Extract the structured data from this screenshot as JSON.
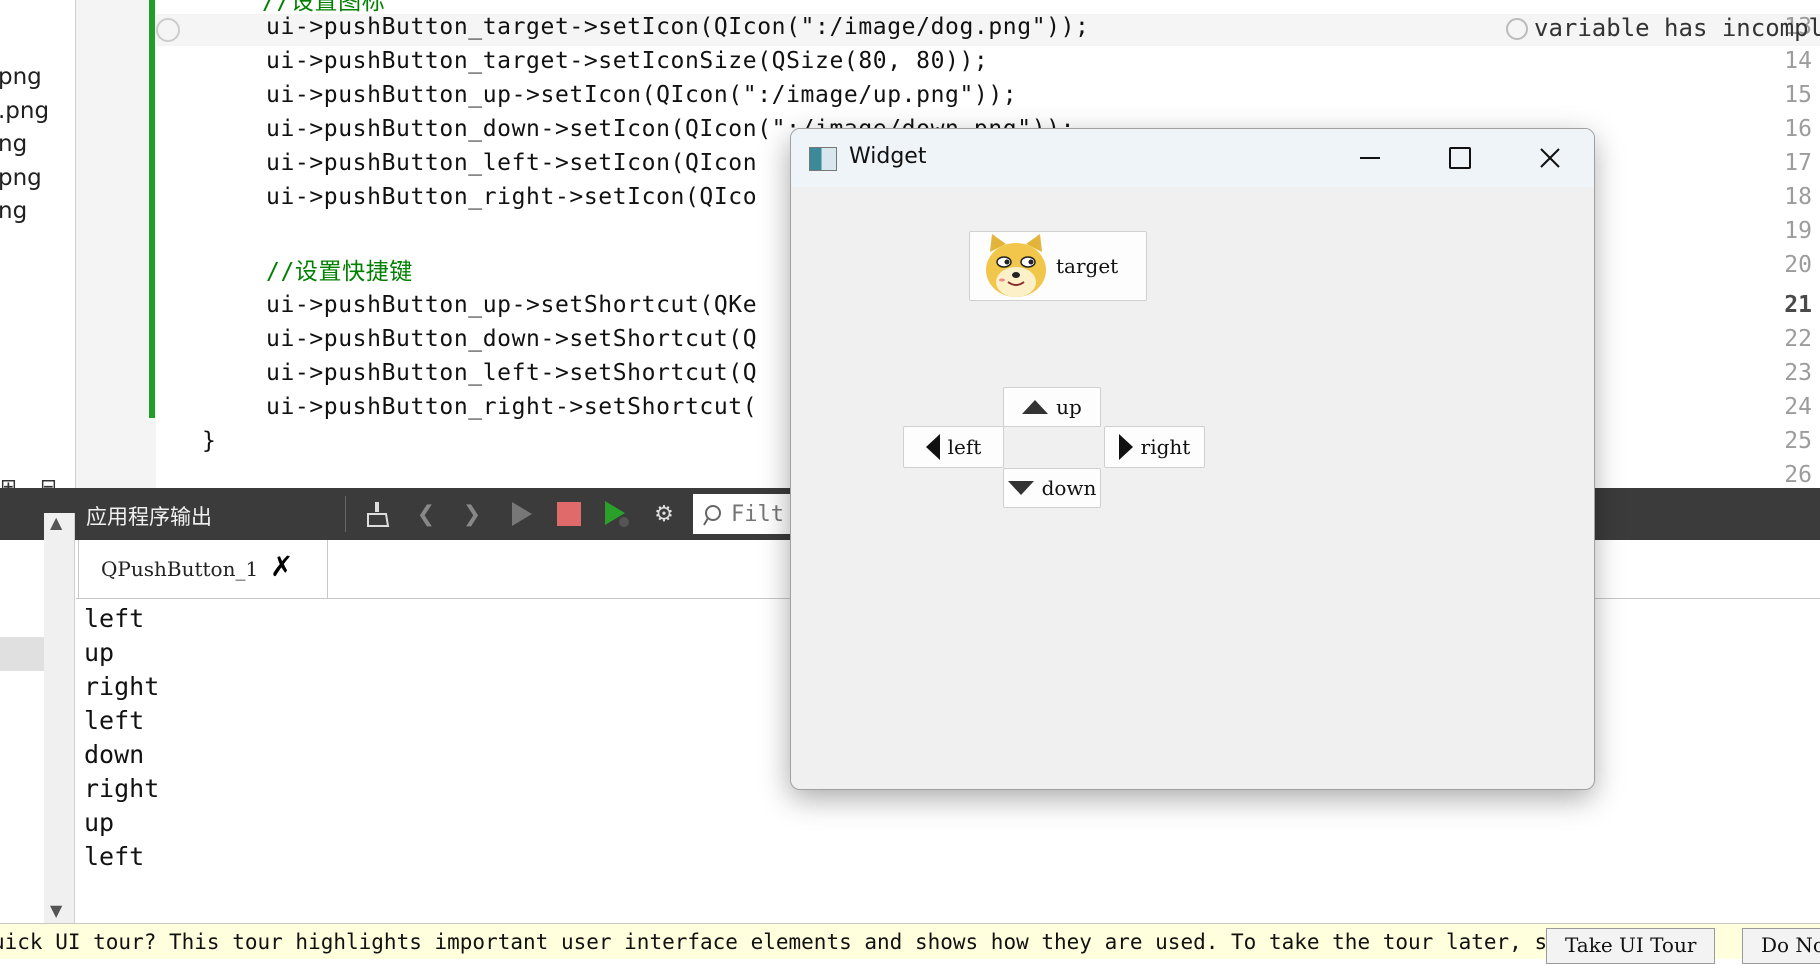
{
  "file_panel": {
    "items": [
      "png",
      ".png",
      "ng",
      "png",
      "ng"
    ]
  },
  "editor": {
    "hidden_top_line": "//设置图标",
    "lines": [
      {
        "no": "13",
        "code": "ui->pushButton_target->setIcon(QIcon(\":/image/dog.png\"));"
      },
      {
        "no": "14",
        "code": "ui->pushButton_target->setIconSize(QSize(80, 80));"
      },
      {
        "no": "15",
        "code": "ui->pushButton_up->setIcon(QIcon(\":/image/up.png\"));"
      },
      {
        "no": "16",
        "code": "ui->pushButton_down->setIcon(QIcon(\":/image/down.png\"));"
      },
      {
        "no": "17",
        "code": "ui->pushButton_left->setIcon(QIcon"
      },
      {
        "no": "18",
        "code": "ui->pushButton_right->setIcon(QIco"
      },
      {
        "no": "19",
        "code": ""
      },
      {
        "no": "20",
        "code": "//设置快捷键"
      },
      {
        "no": "21",
        "code": "ui->pushButton_up->setShortcut(QKe"
      },
      {
        "no": "22",
        "code": "ui->pushButton_down->setShortcut(Q"
      },
      {
        "no": "23",
        "code": "ui->pushButton_left->setShortcut(Q"
      },
      {
        "no": "24",
        "code": "ui->pushButton_right->setShortcut("
      },
      {
        "no": "25",
        "code": "}"
      },
      {
        "no": "26",
        "code": ""
      }
    ],
    "warning": "variable has incomplete"
  },
  "output_panel": {
    "title": "应用程序输出",
    "filter_placeholder": "Filt",
    "tab_label": "QPushButton_1",
    "lines": [
      "left",
      "up",
      "right",
      "left",
      "down",
      "right",
      "up",
      "left"
    ]
  },
  "tour_bar": {
    "text": "uick UI tour? This tour highlights important user interface elements and shows how they are used. To take the tour later, select",
    "take_tour": "Take UI Tour",
    "do_not": "Do No"
  },
  "widget_window": {
    "title": "Widget",
    "buttons": {
      "target": "target",
      "up": "up",
      "down": "down",
      "left": "left",
      "right": "right"
    }
  },
  "colors": {
    "gutter_bar": "#1f9e2a",
    "string": "#007a00",
    "toolbar_bg": "#3b3b3b",
    "tour_bg": "#ffffdd"
  }
}
